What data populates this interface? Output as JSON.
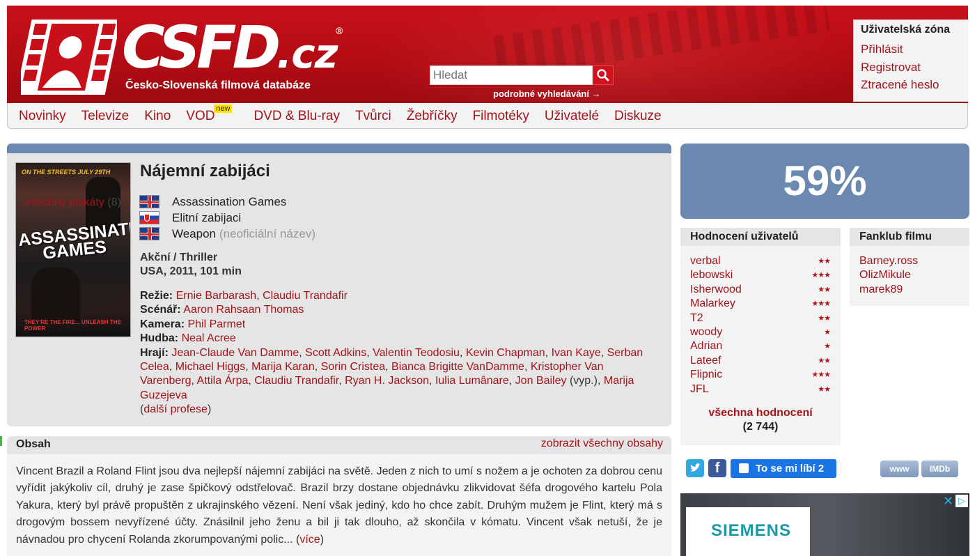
{
  "header": {
    "logo_main": "CSFD",
    "logo_tld": ".cz",
    "logo_reg": "®",
    "tagline": "Česko-Slovenská filmová databáze",
    "search_placeholder": "Hledat",
    "advanced_search": "podrobné vyhledávání →"
  },
  "user_zone": {
    "title": "Uživatelská zóna",
    "login": "Přihlásit",
    "register": "Registrovat",
    "lost_password": "Ztracené heslo"
  },
  "nav": {
    "items": [
      "Novinky",
      "Televize",
      "Kino",
      "VOD",
      "DVD & Blu-ray",
      "Tvůrci",
      "Žebříčky",
      "Filmotéky",
      "Uživatelé",
      "Diskuze"
    ],
    "new_badge": "new"
  },
  "movie": {
    "poster": {
      "tagline_top": "ON THE STREETS JULY 29TH",
      "title": "ASSASSINATION GAMES",
      "bottom": "THEY'RE THE FIRE... UNLEASH THE POWER"
    },
    "all_posters_label": "všechny plakáty",
    "all_posters_count": "(8)",
    "title": "Nájemní zabijáci",
    "names": [
      {
        "flag": "gb",
        "name": "Assassination Games",
        "note": ""
      },
      {
        "flag": "sk",
        "name": "Elitní zabijaci",
        "note": ""
      },
      {
        "flag": "gb",
        "name": "Weapon",
        "note": "(neoficiální název)"
      }
    ],
    "genre": "Akční / Thriller",
    "origin": "USA, 2011, 101 min",
    "credits": {
      "director_label": "Režie:",
      "director": [
        "Ernie Barbarash",
        "Claudiu Trandafir"
      ],
      "writer_label": "Scénář:",
      "writer": [
        "Aaron Rahsaan Thomas"
      ],
      "camera_label": "Kamera:",
      "camera": [
        "Phil Parmet"
      ],
      "music_label": "Hudba:",
      "music": [
        "Neal Acree"
      ],
      "cast_label": "Hrají:",
      "cast": [
        "Jean-Claude Van Damme",
        "Scott Adkins",
        "Valentin Teodosiu",
        "Kevin Chapman",
        "Ivan Kaye",
        "Serban Celea",
        "Michael Higgs",
        "Marija Karan",
        "Sorin Cristea",
        "Bianca Brigitte VanDamme",
        "Kristopher Van Varenberg",
        "Attila Árpa",
        "Claudiu Trandafir",
        "Ryan H. Jackson",
        "Iulia Lumânare",
        "Jon Bailey"
      ],
      "cast_note": "(vyp.),",
      "cast_extra": "Marija Guzejeva",
      "more_professions": "další profese"
    }
  },
  "obsah": {
    "title": "Obsah",
    "show_all": "zobrazit všechny obsahy",
    "text": "Vincent Brazil a Roland Flint jsou dva nejlepší nájemní zabijáci na světě. Jeden z nich to umí s nožem a je ochoten za dobrou cenu vyřídit jakýkoliv cíl, druhý je zase špičkový odstřelovač. Brazil brzy dostane objednávku zlikvidovat šéfa drogového kartelu Pola Yakura, který byl právě propuštěn z ukrajinského vězení. Není však jediný, kdo ho chce zabít. Druhým mužem je Flint, který má s drogovým bossem nevyřízené účty. Znásilnil jeho ženu a bil ji tak dlouho, až skončila v kómatu. Vincent však netuší, že je návnadou pro chycení Rolanda zkorumpovanými polic...",
    "more": "více"
  },
  "rating": {
    "percent": "59%"
  },
  "user_ratings": {
    "title": "Hodnocení uživatelů",
    "items": [
      {
        "user": "verbal",
        "stars": "★★"
      },
      {
        "user": "lebowski",
        "stars": "★★★"
      },
      {
        "user": "Isherwood",
        "stars": "★★"
      },
      {
        "user": "Malarkey",
        "stars": "★★★"
      },
      {
        "user": "T2",
        "stars": "★★"
      },
      {
        "user": "woody",
        "stars": "★"
      },
      {
        "user": "Adrian",
        "stars": "★"
      },
      {
        "user": "Lateef",
        "stars": "★★"
      },
      {
        "user": "Flipnic",
        "stars": "★★★"
      },
      {
        "user": "JFL",
        "stars": "★★"
      }
    ],
    "all_label": "všechna hodnocení",
    "all_count": "(2 744)"
  },
  "fanclub": {
    "title": "Fanklub filmu",
    "members": [
      "Barney.ross",
      "OlizMikule",
      "marek89"
    ]
  },
  "social": {
    "like_label": "To se mi líbí 2",
    "www": "www",
    "imdb": "IMDb"
  },
  "ad": {
    "brand": "SIEMENS"
  }
}
